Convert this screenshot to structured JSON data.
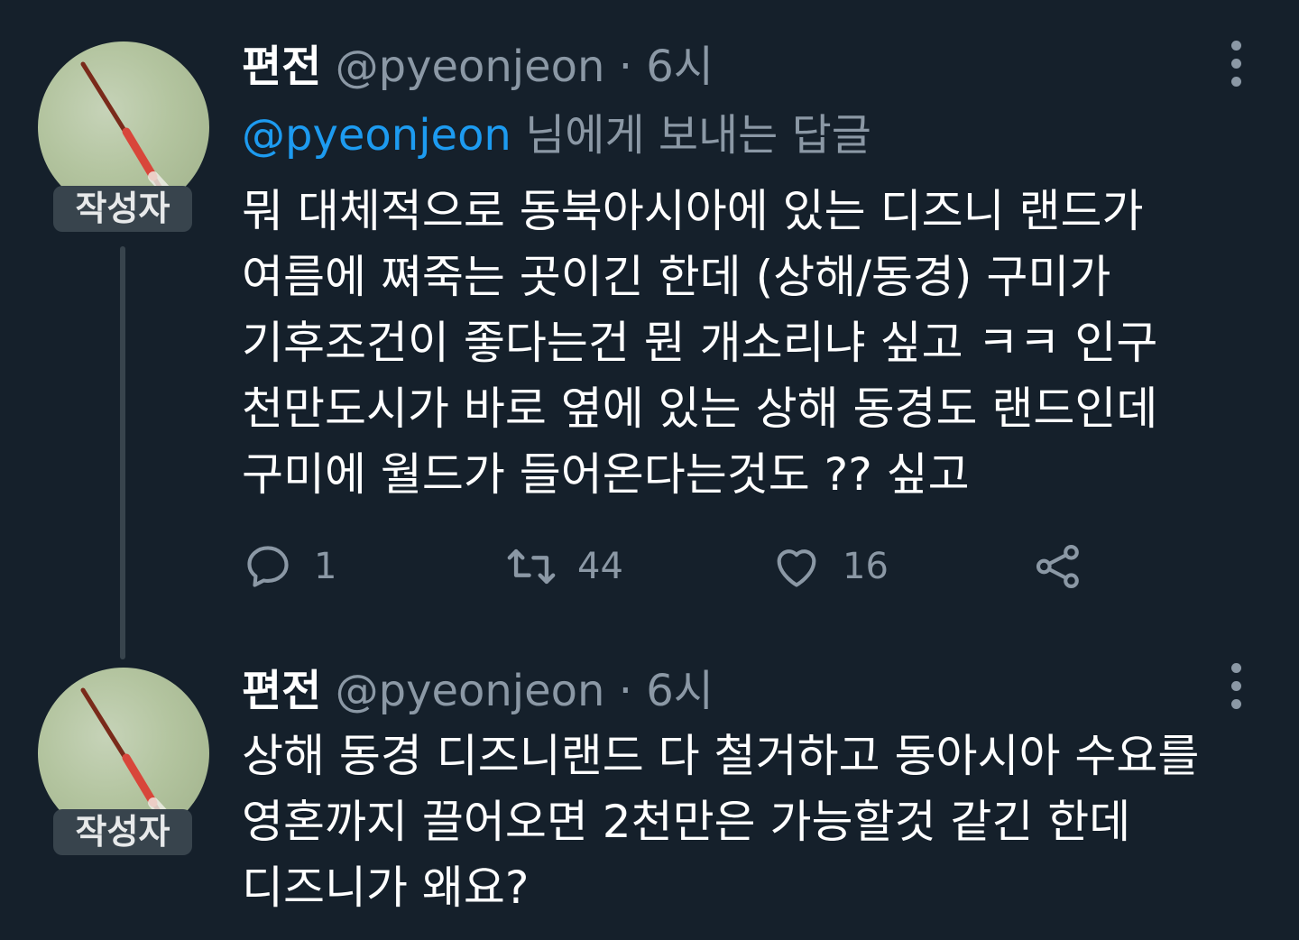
{
  "tweets": [
    {
      "author_name": "편전",
      "handle": "@pyeonjeon",
      "separator": "·",
      "time": "6시",
      "badge": "작성자",
      "replying_to_mention": "@pyeonjeon",
      "replying_to_suffix": "님에게 보내는 답글",
      "text": "뭐 대체적으로 동북아시아에 있는 디즈니 랜드가\n여름에 쪄죽는 곳이긴 한데 (상해/동경) 구미가\n기후조건이 좋다는건 뭔 개소리냐 싶고 ㅋㅋ 인구\n천만도시가 바로 옆에 있는 상해 동경도 랜드인데\n구미에 월드가 들어온다는것도 ?? 싶고",
      "actions": {
        "reply_count": "1",
        "retweet_count": "44",
        "like_count": "16"
      }
    },
    {
      "author_name": "편전",
      "handle": "@pyeonjeon",
      "separator": "·",
      "time": "6시",
      "badge": "작성자",
      "text": "상해 동경 디즈니랜드 다 철거하고 동아시아 수요를\n영혼까지 끌어오면 2천만은 가능할것 같긴 한데\n디즈니가 왜요?"
    }
  ],
  "icons": {
    "reply": "speech-bubble-icon",
    "retweet": "retweet-icon",
    "like": "heart-icon",
    "share": "share-icon",
    "more": "vertical-dots-icon"
  },
  "colors": {
    "background": "#15202b",
    "text": "#ffffff",
    "secondary": "#8b98a5",
    "accent": "#1d9bf0",
    "badge_bg": "#38444d"
  }
}
